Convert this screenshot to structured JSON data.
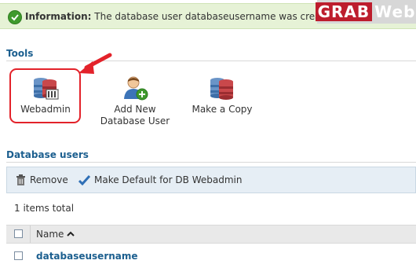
{
  "info": {
    "label": "Information:",
    "message": "The database user databaseusername was created."
  },
  "watermark": {
    "part1": "GRAB",
    "part2": "Web"
  },
  "tools": {
    "title": "Tools",
    "items": [
      {
        "line1": "Webadmin",
        "line2": ""
      },
      {
        "line1": "Add New",
        "line2": "Database User"
      },
      {
        "line1": "Make a Copy",
        "line2": ""
      }
    ]
  },
  "db_users": {
    "title": "Database users",
    "toolbar": {
      "remove": "Remove",
      "make_default": "Make Default for DB Webadmin"
    },
    "total": "1 items total",
    "table": {
      "header_name": "Name",
      "rows": [
        {
          "name": "databaseusername"
        }
      ]
    }
  },
  "colors": {
    "accent_title": "#1c5f8f",
    "highlight": "#e3222a",
    "info_bg": "#e6f2d6"
  }
}
